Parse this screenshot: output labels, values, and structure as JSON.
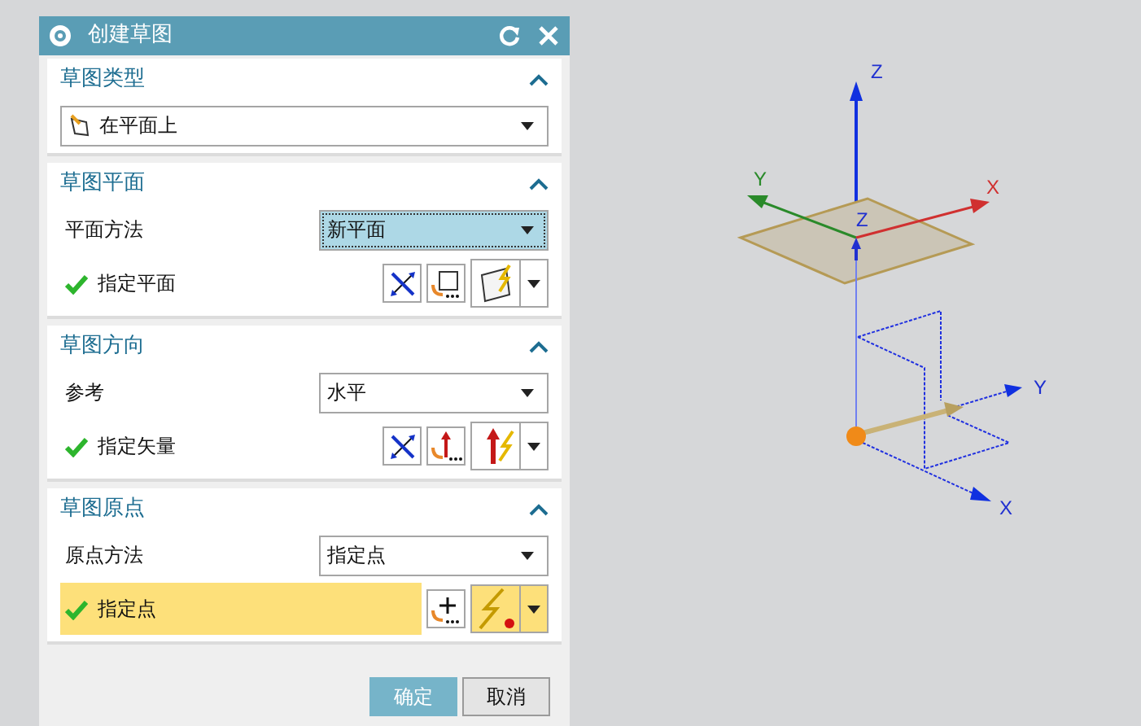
{
  "window": {
    "title": "创建草图"
  },
  "sections": [
    {
      "title": "草图类型",
      "expanded": true,
      "rows": [
        {
          "kind": "select",
          "value": "在平面上",
          "focused": false
        }
      ]
    },
    {
      "title": "草图平面",
      "expanded": true,
      "rows": [
        {
          "kind": "field",
          "label": "平面方法",
          "value": "新平面",
          "focused": true
        },
        {
          "kind": "plane-action",
          "label": "指定平面",
          "done": true,
          "highlighted": false
        }
      ]
    },
    {
      "title": "草图方向",
      "expanded": true,
      "rows": [
        {
          "kind": "field",
          "label": "参考",
          "value": "水平",
          "focused": false
        },
        {
          "kind": "vector-action",
          "label": "指定矢量",
          "done": true,
          "highlighted": false
        }
      ]
    },
    {
      "title": "草图原点",
      "expanded": true,
      "rows": [
        {
          "kind": "field",
          "label": "原点方法",
          "value": "指定点",
          "focused": false
        },
        {
          "kind": "point-action",
          "label": "指定点",
          "done": true,
          "highlighted": true
        }
      ]
    }
  ],
  "buttons": [
    {
      "label": "确定",
      "kind": "primary"
    },
    {
      "label": "取消",
      "kind": "default"
    }
  ],
  "viewport": {
    "axis_labels": [
      "Z",
      "Y",
      "X",
      "Z",
      "Y",
      "X"
    ]
  }
}
